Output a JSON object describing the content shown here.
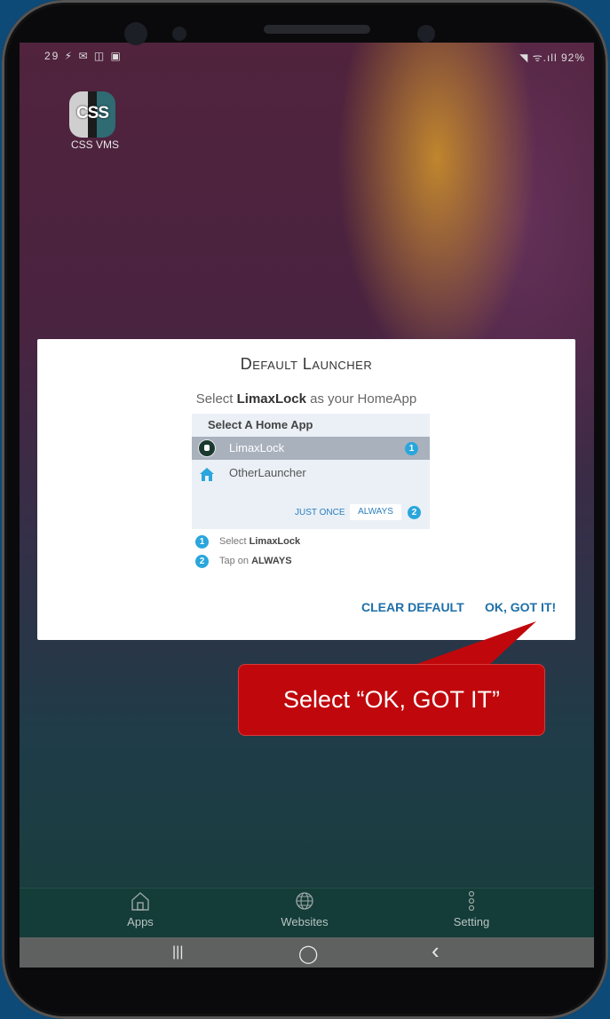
{
  "status_bar": {
    "left": "29 ⚡ ✉ ◫ ▣",
    "right": "◥ ᯤ.ıll 92%"
  },
  "home": {
    "app_icon_text": "CSS",
    "app_label": "CSS VMS"
  },
  "dialog": {
    "title": "Default Launcher",
    "subtitle_prefix": "Select ",
    "subtitle_app": "LimaxLock",
    "subtitle_suffix": " as your HomeApp",
    "preview": {
      "header": "Select A Home App",
      "selected_item": "LimaxLock",
      "selected_badge": "1",
      "other_item": "OtherLauncher",
      "just_once": "JUST ONCE",
      "always": "ALWAYS",
      "always_badge": "2"
    },
    "steps": [
      {
        "badge": "1",
        "prefix": "Select ",
        "bold": "LimaxLock"
      },
      {
        "badge": "2",
        "prefix": "Tap on ",
        "bold": "ALWAYS"
      }
    ],
    "clear_default": "CLEAR DEFAULT",
    "ok_got_it": "OK, GOT IT!"
  },
  "callout": {
    "text": "Select “OK, GOT IT”"
  },
  "bottom_nav": [
    {
      "label": "Apps",
      "icon": "home-icon"
    },
    {
      "label": "Websites",
      "icon": "globe-icon"
    },
    {
      "label": "Setting",
      "icon": "more-vertical-icon"
    }
  ],
  "system_nav": {
    "recents": "|||",
    "home": "◯",
    "back": "‹"
  },
  "colors": {
    "accent_blue": "#1e6fa8",
    "badge_blue": "#2aa6dc",
    "callout_red": "#c0080c"
  }
}
